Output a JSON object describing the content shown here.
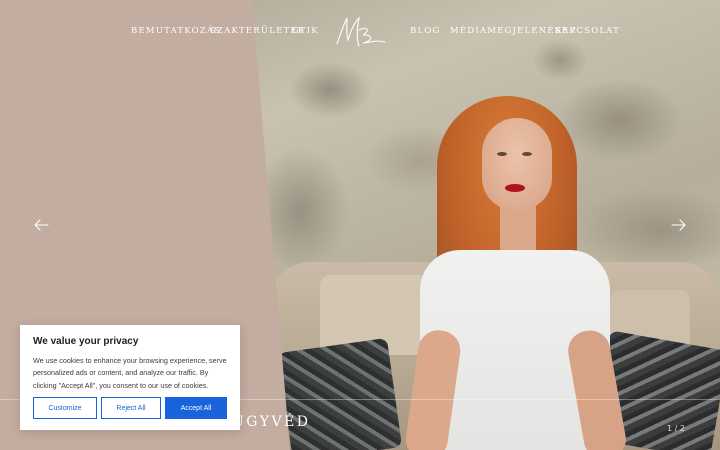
{
  "nav": {
    "left_items": [
      "BEMUTATKOZÁS",
      "SZAKTERÜLETEK",
      "GYIK"
    ],
    "right_items": [
      "BLOG",
      "MÉDIAMEGJELENÉSEK",
      "KAPCSOLAT"
    ],
    "logo_icon": "signature-logo-icon"
  },
  "slider": {
    "prev_icon": "arrow-left-icon",
    "next_icon": "arrow-right-icon",
    "title": "ÜGYVÉD",
    "counter": "1 / 2"
  },
  "cookie": {
    "title": "We value your privacy",
    "text": "We use cookies to enhance your browsing experience, serve personalized ads or content, and analyze our traffic. By clicking \"Accept All\", you consent to our use of cookies.",
    "customize_label": "Customize",
    "reject_label": "Reject All",
    "accept_label": "Accept All",
    "accent_color": "#1863dc"
  }
}
